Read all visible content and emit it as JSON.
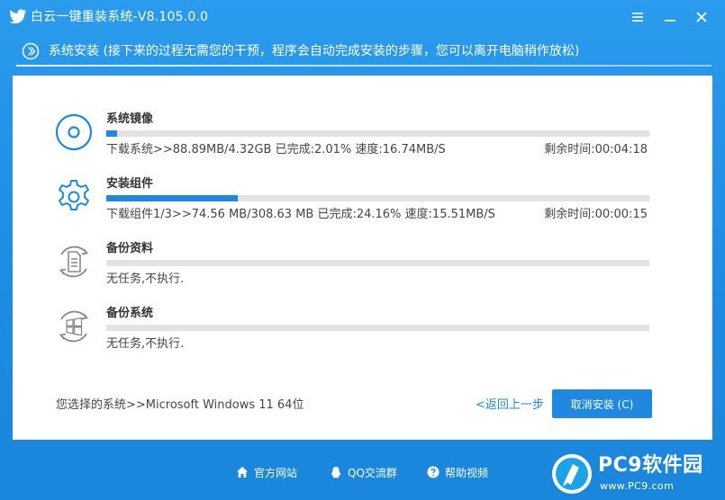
{
  "window": {
    "title": "白云一键重装系统-V8.105.0.0",
    "controls": [
      "menu-icon",
      "minimize-icon",
      "close-icon"
    ]
  },
  "step": {
    "text": "系统安装 (接下来的过程无需您的干预，程序会自动完成安装的步骤，您可以离开电脑稍作放松)"
  },
  "tasks": [
    {
      "name": "系统镜像",
      "icon": "disc-icon",
      "progress": 0.0201,
      "detail": "下载系统>>88.89MB/4.32GB 已完成:2.01%  速度:16.74MB/S",
      "remaining": "剩余时间:00:04:18"
    },
    {
      "name": "安装组件",
      "icon": "gear-icon",
      "progress": 0.2416,
      "detail": "下载组件1/3>>74.56 MB/308.63 MB 已完成:24.16%  速度:15.51MB/S",
      "remaining": "剩余时间:00:00:15"
    },
    {
      "name": "备份资料",
      "icon": "document-backup-icon",
      "progress": 0,
      "detail": "无任务,不执行.",
      "remaining": ""
    },
    {
      "name": "备份系统",
      "icon": "windows-backup-icon",
      "progress": 0,
      "detail": "无任务,不执行.",
      "remaining": ""
    }
  ],
  "selected_system": "您选择的系统>>Microsoft Windows 11 64位",
  "back_link": "<返回上一步",
  "cancel_button": "取消安装 (C)",
  "footer": {
    "links": [
      {
        "label": "官方网站",
        "icon": "home-icon"
      },
      {
        "label": "QQ交流群",
        "icon": "qq-icon"
      },
      {
        "label": "帮助视频",
        "icon": "help-icon"
      }
    ]
  },
  "watermark": {
    "text": "PC9软件园",
    "url": "www.PC9.com"
  },
  "colors": {
    "accent": "#1f88e0",
    "titlebar": "#2b9bee",
    "progress_track": "#e2e2e2"
  }
}
